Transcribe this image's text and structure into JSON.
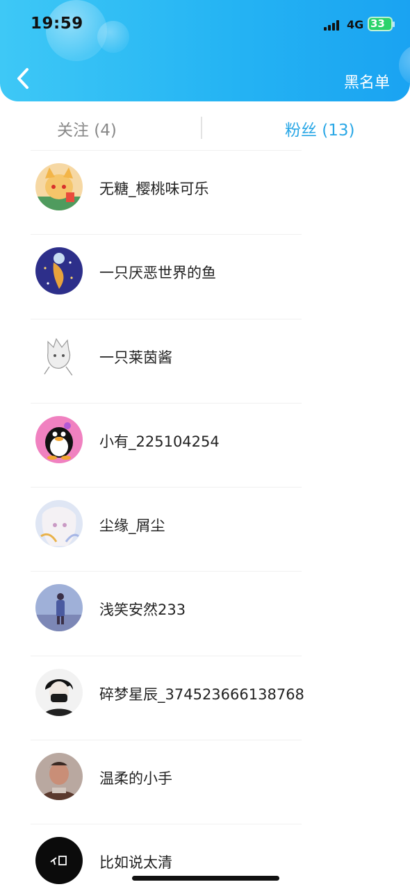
{
  "status_bar": {
    "time": "19:59",
    "network": "4G",
    "battery": "33"
  },
  "header": {
    "back_icon": "chevron-left-icon",
    "right_action": "黑名单"
  },
  "tabs": [
    {
      "label": "关注 (4)",
      "active": false
    },
    {
      "label": "粉丝 (13)",
      "active": true
    }
  ],
  "accent_color": "#29a7e6",
  "header_gradient": [
    "#3ec8f6",
    "#1aa3f2"
  ],
  "fans": [
    {
      "name": "无糖_樱桃味可乐",
      "avatar": "cartoon-fox-avatar"
    },
    {
      "name": "一只厌恶世界的鱼",
      "avatar": "fish-moon-avatar"
    },
    {
      "name": "一只莱茵酱",
      "avatar": "anime-sketch-avatar"
    },
    {
      "name": "小有_225104254",
      "avatar": "penguin-avatar"
    },
    {
      "name": "尘缘_屑尘",
      "avatar": "anime-girl-avatar"
    },
    {
      "name": "浅笑安然233",
      "avatar": "person-landscape-avatar"
    },
    {
      "name": "碎梦星辰_374523666138768",
      "avatar": "masked-boy-avatar"
    },
    {
      "name": "温柔的小手",
      "avatar": "photo-man-avatar"
    },
    {
      "name": "比如说太清",
      "avatar": "black-circle-avatar"
    }
  ]
}
